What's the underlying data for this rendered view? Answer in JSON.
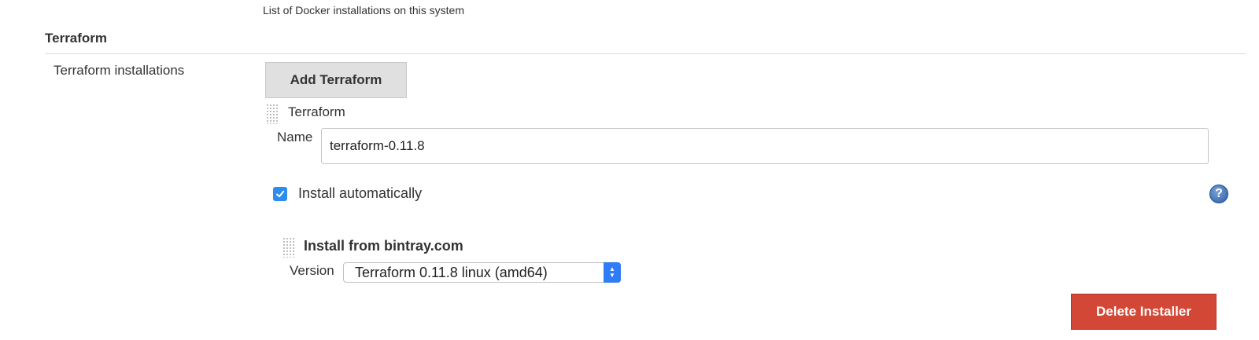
{
  "docker_section": {
    "description": "List of Docker installations on this system"
  },
  "terraform_section": {
    "title": "Terraform",
    "field_label": "Terraform installations",
    "add_button_label": "Add Terraform",
    "installation": {
      "title": "Terraform",
      "name_label": "Name",
      "name_value": "terraform-0.11.8",
      "install_auto_label": "Install automatically",
      "install_auto_checked": true,
      "help_icon": "question-mark-icon",
      "installer": {
        "title": "Install from bintray.com",
        "version_label": "Version",
        "version_selected": "Terraform 0.11.8 linux (amd64)",
        "delete_button_label": "Delete Installer"
      }
    }
  },
  "colors": {
    "delete_button": "#d24735",
    "checkbox": "#2d8cf0",
    "select_stepper": "#2f7cf6",
    "add_button_bg": "#e0e0e0"
  }
}
